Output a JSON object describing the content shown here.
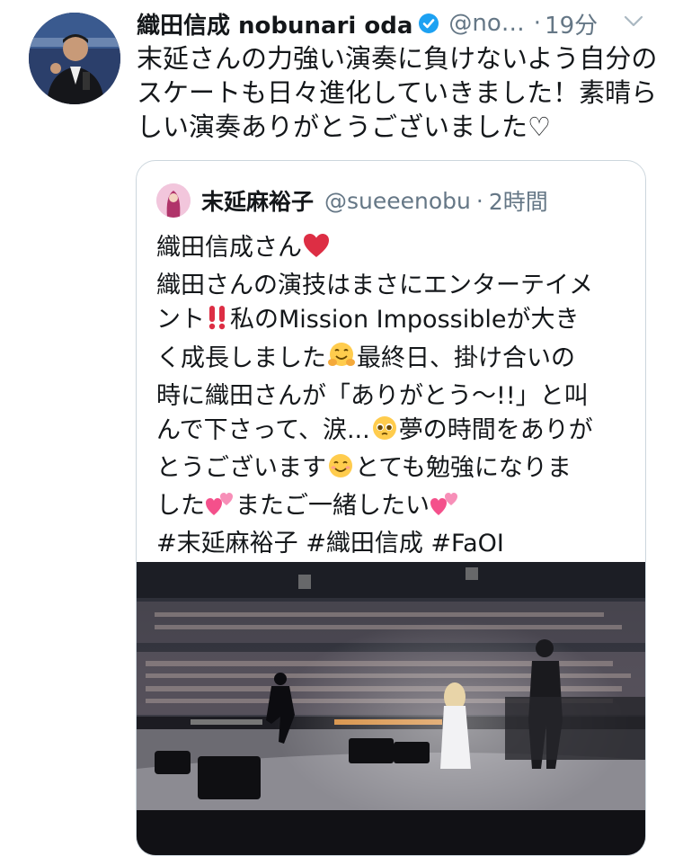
{
  "tweet": {
    "author_name": "織田信成 nobunari oda",
    "handle": "@no…",
    "separator": "·",
    "time": "19分",
    "text": "末延さんの力強い演奏に負けないよう自分の\nスケートも日々進化していきました！素晴ら\nしい演奏ありがとうございました♡"
  },
  "quote": {
    "author_name": "末延麻裕子",
    "handle": "@sueeenobu",
    "separator": "·",
    "time": "2時間",
    "lines": {
      "l1": "織田信成さん",
      "l2": "織田さんの演技はまさにエンターテイメ",
      "l3a": "ント",
      "l3b": "私のMission Impossibleが大き",
      "l4a": "く成長しました",
      "l4b": "最終日、掛け合いの",
      "l5": "時に織田さんが「ありがとう〜!!」と叫",
      "l6a": "んで下さって、涙...",
      "l6b": "夢の時間をありが",
      "l7a": "とうございます",
      "l7b": "とても勉強になりま",
      "l8a": "した",
      "l8b": "またご一緒したい",
      "l9": "#末延麻裕子 #織田信成 #FaOI"
    }
  },
  "icons": {
    "verified": "verified-badge-icon",
    "chevron": "chevron-down-icon"
  },
  "colors": {
    "text": "#14171a",
    "secondary": "#657786",
    "verified": "#1da1f2",
    "border": "#ccd6dd"
  }
}
